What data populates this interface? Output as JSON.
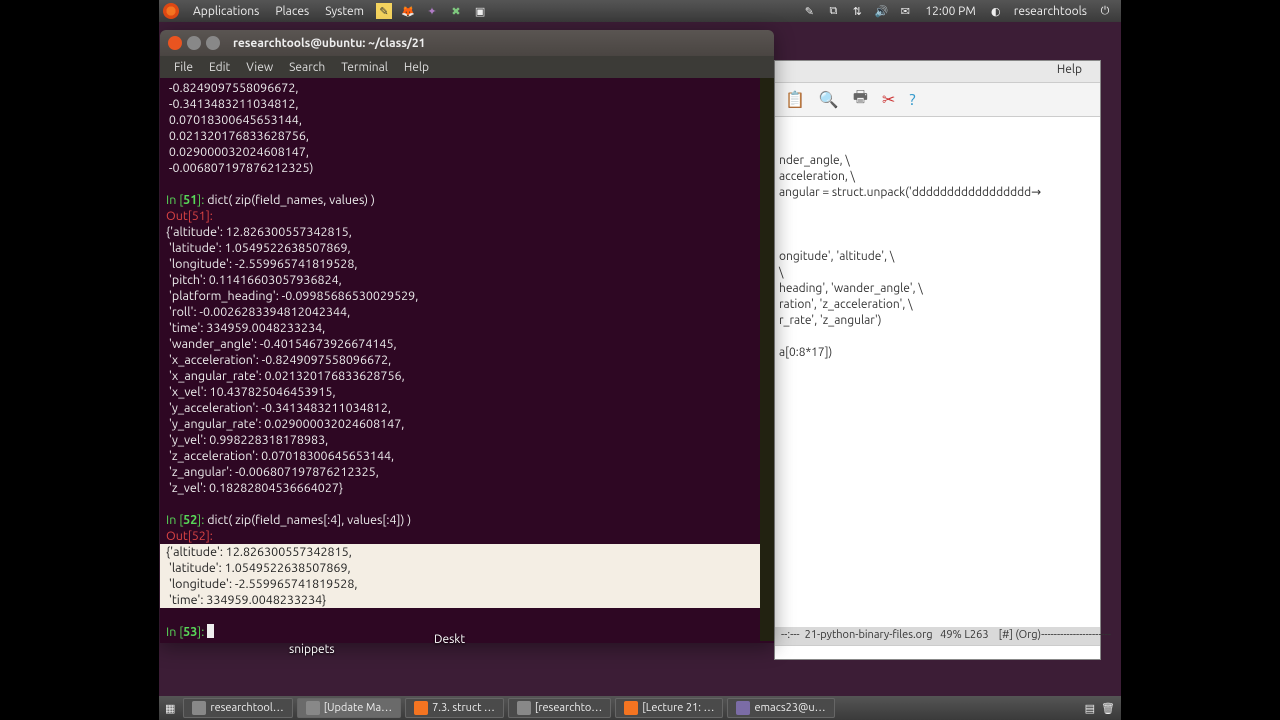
{
  "panel": {
    "menus": [
      "Applications",
      "Places",
      "System"
    ],
    "clock": "12:00 PM",
    "user": "researchtools"
  },
  "terminal": {
    "title": "researchtools@ubuntu: ~/class/21",
    "menus": [
      "File",
      "Edit",
      "View",
      "Search",
      "Terminal",
      "Help"
    ],
    "pre_values": " -0.8249097558096672,\n -0.3413483211034812,\n 0.07018300645653144,\n 0.021320176833628756,\n 0.029000032024608147,\n -0.006807197876212325)",
    "in51": "In [51]: ",
    "cmd51": "dict( zip(field_names, values) )",
    "out51": "Out[51]:",
    "dict51": "{'altitude': 12.826300557342815,\n 'latitude': 1.0549522638507869,\n 'longitude': -2.559965741819528,\n 'pitch': 0.11416603057936824,\n 'platform_heading': -0.09985686530029529,\n 'roll': -0.0026283394812042344,\n 'time': 334959.0048233234,\n 'wander_angle': -0.40154673926674145,\n 'x_acceleration': -0.8249097558096672,\n 'x_angular_rate': 0.021320176833628756,\n 'x_vel': 10.437825046453915,\n 'y_acceleration': -0.3413483211034812,\n 'y_angular_rate': 0.029000032024608147,\n 'y_vel': 0.998228318178983,\n 'z_acceleration': 0.07018300645653144,\n 'z_angular': -0.006807197876212325,\n 'z_vel': 0.18282804536664027}",
    "in52": "In [52]: ",
    "cmd52": "dict( zip(field_names[:4], values[:4]) )",
    "out52": "Out[52]:",
    "dict52": "{'altitude': 12.826300557342815,\n 'latitude': 1.0549522638507869,\n 'longitude': -2.559965741819528,\n 'time': 334959.0048233234}",
    "in53": "In [53]: "
  },
  "emacs": {
    "menu_help": "Help",
    "body": "                                      \n                                      \nnder_angle, \\\nacceleration, \\\nangular = struct.unpack('ddddddddddddddddd→\n\n\n\nongitude', 'altitude', \\\n\\\nheading', 'wander_angle', \\\nration', 'z_acceleration', \\\nr_rate', 'z_angular')\n\na[0:8*17])",
    "status": "--:---  21-python-binary-files.org   49% L263    [#] (Org)----------------------"
  },
  "desktop": {
    "snippets_label": "snippets",
    "desktop_label": "Deskt"
  },
  "taskbar": {
    "items": [
      "researchtool…",
      "[Update Ma…",
      "7.3. struct …",
      "[researchto…",
      "[Lecture 21: …",
      "emacs23@u…"
    ]
  }
}
